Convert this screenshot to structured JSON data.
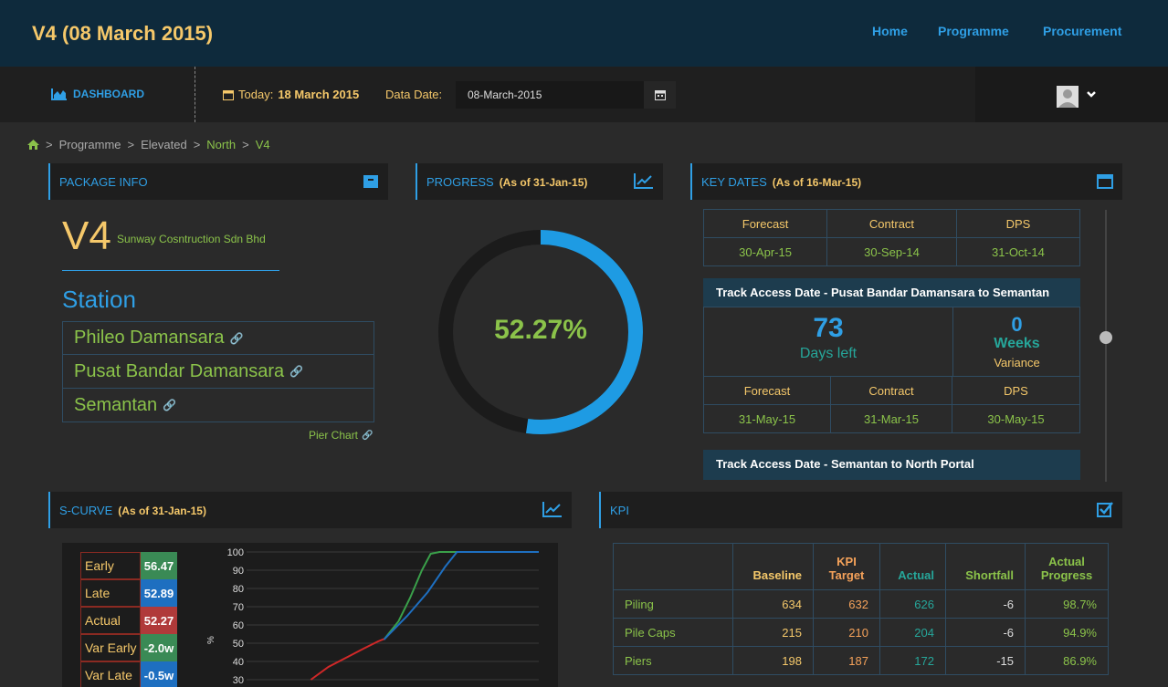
{
  "header": {
    "title": "V4 (08 March 2015)",
    "nav": [
      "Home",
      "Programme",
      "Procurement"
    ]
  },
  "subbar": {
    "dashboard": "DASHBOARD",
    "today_prefix": "Today:",
    "today_value": "18 March 2015",
    "data_date_label": "Data Date:",
    "data_date_value": "08-March-2015"
  },
  "breadcrumb": [
    "Programme",
    "Elevated",
    "North",
    "V4"
  ],
  "package_info": {
    "title": "PACKAGE INFO",
    "code": "V4",
    "company": "Sunway Cosntruction Sdn Bhd",
    "station_heading": "Station",
    "stations": [
      "Phileo Damansara",
      "Pusat Bandar Damansara",
      "Semantan"
    ],
    "pier_chart": "Pier Chart"
  },
  "progress": {
    "title": "PROGRESS",
    "subtitle": "(As of 31-Jan-15)",
    "value_text": "52.27%",
    "fraction": 0.5227
  },
  "key_dates": {
    "title": "KEY DATES",
    "subtitle": "(As of 16-Mar-15)",
    "cols": [
      "Forecast",
      "Contract",
      "DPS"
    ],
    "row1": [
      "30-Apr-15",
      "30-Sep-14",
      "31-Oct-14"
    ],
    "track1": {
      "title": "Track Access Date - Pusat Bandar Damansara to Semantan",
      "days": "73",
      "days_label": "Days left",
      "weeks": "0",
      "weeks_label": "Weeks",
      "variance_label": "Variance",
      "dates": [
        "31-May-15",
        "31-Mar-15",
        "30-May-15"
      ]
    },
    "track2": {
      "title": "Track Access Date - Semantan to North Portal"
    }
  },
  "scurve": {
    "title": "S-CURVE",
    "subtitle": "(As of 31-Jan-15)",
    "legend": [
      {
        "label": "Early",
        "value": "56.47",
        "color": "#3a8a55"
      },
      {
        "label": "Late",
        "value": "52.89",
        "color": "#1e6fc0"
      },
      {
        "label": "Actual",
        "value": "52.27",
        "color": "#b03a3a"
      },
      {
        "label": "Var Early",
        "value": "-2.0w",
        "color": "#3a8a55"
      },
      {
        "label": "Var Late",
        "value": "-0.5w",
        "color": "#1e6fc0"
      }
    ]
  },
  "chart_data": {
    "type": "line",
    "ylabel": "%",
    "ylim": [
      30,
      100
    ],
    "yticks": [
      "100",
      "90",
      "80",
      "70",
      "60",
      "50",
      "40",
      "30"
    ],
    "grid": true,
    "series": [
      {
        "color": "#3aa04a",
        "points": [
          [
            0.47,
            52
          ],
          [
            0.52,
            62
          ],
          [
            0.56,
            75
          ],
          [
            0.6,
            90
          ],
          [
            0.63,
            99
          ],
          [
            0.66,
            100
          ],
          [
            1.0,
            100
          ]
        ]
      },
      {
        "color": "#1e6fc0",
        "points": [
          [
            0.47,
            52
          ],
          [
            0.55,
            65
          ],
          [
            0.62,
            78
          ],
          [
            0.68,
            92
          ],
          [
            0.72,
            100
          ],
          [
            1.0,
            100
          ]
        ]
      },
      {
        "color": "#d02828",
        "points": [
          [
            0.22,
            30
          ],
          [
            0.28,
            37
          ],
          [
            0.34,
            42
          ],
          [
            0.4,
            47
          ],
          [
            0.45,
            51
          ],
          [
            0.47,
            52.27
          ]
        ]
      }
    ]
  },
  "kpi": {
    "title": "KPI",
    "headers": [
      "",
      "Baseline",
      "KPI Target",
      "Actual",
      "Shortfall",
      "Actual Progress"
    ],
    "rows": [
      [
        "Piling",
        "634",
        "632",
        "626",
        "-6",
        "98.7%"
      ],
      [
        "Pile Caps",
        "215",
        "210",
        "204",
        "-6",
        "94.9%"
      ],
      [
        "Piers",
        "198",
        "187",
        "172",
        "-15",
        "86.9%"
      ]
    ]
  }
}
